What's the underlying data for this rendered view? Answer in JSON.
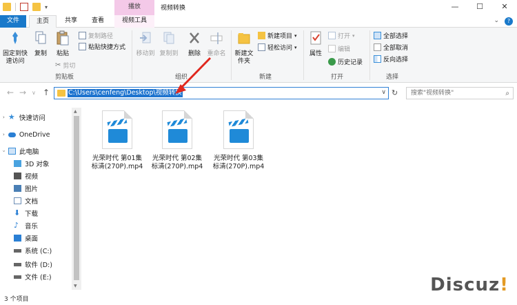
{
  "window": {
    "title": "视频转换",
    "context_tab_header": "播放",
    "help": "?"
  },
  "tabs": [
    {
      "label": "文件"
    },
    {
      "label": "主页"
    },
    {
      "label": "共享"
    },
    {
      "label": "查看"
    },
    {
      "label": "视频工具"
    }
  ],
  "ribbon": {
    "clipboard": {
      "pin": "固定到快速访问",
      "copy": "复制",
      "paste": "粘贴",
      "copy_path": "复制路径",
      "paste_shortcut": "粘贴快捷方式",
      "cut": "剪切",
      "label": "剪贴板"
    },
    "organize": {
      "move_to": "移动到",
      "copy_to": "复制到",
      "delete": "删除",
      "rename": "重命名",
      "label": "组织"
    },
    "new": {
      "new_folder": "新建文件夹",
      "new_item": "新建项目",
      "easy_access": "轻松访问",
      "label": "新建"
    },
    "open": {
      "properties": "属性",
      "open": "打开",
      "edit": "编辑",
      "history": "历史记录",
      "label": "打开"
    },
    "select": {
      "select_all": "全部选择",
      "select_none": "全部取消",
      "invert": "反向选择",
      "label": "选择"
    }
  },
  "address": {
    "path": "C:\\Users\\cenfeng\\Desktop\\视频转换",
    "search_placeholder": "搜索\"视频转换\""
  },
  "navpane": [
    {
      "label": "快速访问",
      "icon": "star-icon",
      "color": "#3a8fd9"
    },
    {
      "label": "OneDrive",
      "icon": "cloud-icon",
      "color": "#2a7fd4"
    },
    {
      "label": "此电脑",
      "icon": "computer-icon",
      "color": "#3a8fd9"
    },
    {
      "label": "3D 对象",
      "icon": "cube-icon",
      "color": "#4aa3e0"
    },
    {
      "label": "视频",
      "icon": "video-icon",
      "color": "#555555"
    },
    {
      "label": "图片",
      "icon": "picture-icon",
      "color": "#4a7fb5"
    },
    {
      "label": "文档",
      "icon": "document-icon",
      "color": "#6b8db5"
    },
    {
      "label": "下载",
      "icon": "download-icon",
      "color": "#2a7fd4"
    },
    {
      "label": "音乐",
      "icon": "music-icon",
      "color": "#2a7fd4"
    },
    {
      "label": "桌面",
      "icon": "desktop-icon",
      "color": "#2a7fd4"
    },
    {
      "label": "系统 (C:)",
      "icon": "drive-icon",
      "color": "#666666"
    },
    {
      "label": "软件 (D:)",
      "icon": "drive-icon",
      "color": "#666666"
    },
    {
      "label": "文件 (E:)",
      "icon": "drive-icon",
      "color": "#666666"
    }
  ],
  "files": [
    {
      "line1": "光荣时代 第01集",
      "line2": "标清(270P).mp4"
    },
    {
      "line1": "光荣时代 第02集",
      "line2": "标清(270P).mp4"
    },
    {
      "line1": "光荣时代 第03集",
      "line2": "标清(270P).mp4"
    }
  ],
  "status": {
    "count": "3 个项目"
  },
  "watermark": {
    "text": "Discuz",
    "mark": "!"
  }
}
